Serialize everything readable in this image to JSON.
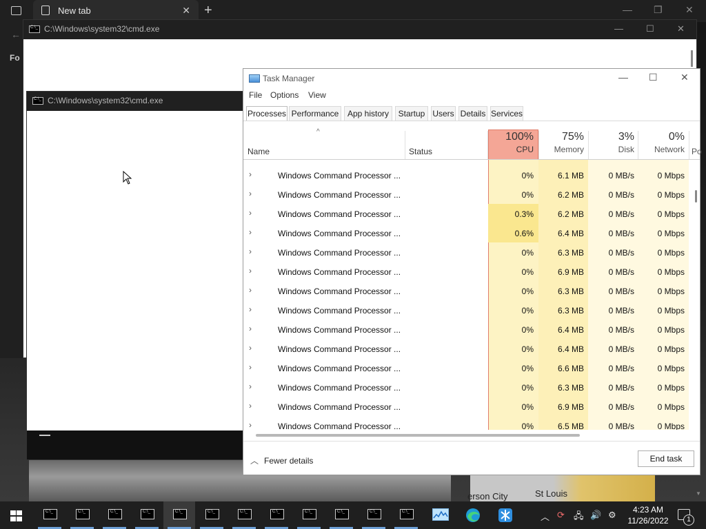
{
  "browser": {
    "tab_title": "New tab",
    "side_text": "Fo"
  },
  "cmd_window_back": {
    "title": "C:\\Windows\\system32\\cmd.exe"
  },
  "cmd_window_front": {
    "title": "C:\\Windows\\system32\\cmd.exe"
  },
  "task_manager": {
    "title": "Task Manager",
    "menu": [
      "File",
      "Options",
      "View"
    ],
    "tabs": [
      "Processes",
      "Performance",
      "App history",
      "Startup",
      "Users",
      "Details",
      "Services"
    ],
    "active_tab": "Processes",
    "columns": {
      "name": "Name",
      "status": "Status",
      "cpu": {
        "pct": "100%",
        "label": "CPU"
      },
      "memory": {
        "pct": "75%",
        "label": "Memory"
      },
      "disk": {
        "pct": "3%",
        "label": "Disk"
      },
      "network": {
        "pct": "0%",
        "label": "Network"
      },
      "next": "Po"
    },
    "rows": [
      {
        "name": "Windows Command Processor ...",
        "cpu": "0%",
        "memory": "6.1 MB",
        "disk": "0 MB/s",
        "network": "0 Mbps"
      },
      {
        "name": "Windows Command Processor ...",
        "cpu": "0%",
        "memory": "6.2 MB",
        "disk": "0 MB/s",
        "network": "0 Mbps"
      },
      {
        "name": "Windows Command Processor ...",
        "cpu": "0.3%",
        "memory": "6.2 MB",
        "disk": "0 MB/s",
        "network": "0 Mbps"
      },
      {
        "name": "Windows Command Processor ...",
        "cpu": "0.6%",
        "memory": "6.4 MB",
        "disk": "0 MB/s",
        "network": "0 Mbps"
      },
      {
        "name": "Windows Command Processor ...",
        "cpu": "0%",
        "memory": "6.3 MB",
        "disk": "0 MB/s",
        "network": "0 Mbps"
      },
      {
        "name": "Windows Command Processor ...",
        "cpu": "0%",
        "memory": "6.9 MB",
        "disk": "0 MB/s",
        "network": "0 Mbps"
      },
      {
        "name": "Windows Command Processor ...",
        "cpu": "0%",
        "memory": "6.3 MB",
        "disk": "0 MB/s",
        "network": "0 Mbps"
      },
      {
        "name": "Windows Command Processor ...",
        "cpu": "0%",
        "memory": "6.3 MB",
        "disk": "0 MB/s",
        "network": "0 Mbps"
      },
      {
        "name": "Windows Command Processor ...",
        "cpu": "0%",
        "memory": "6.4 MB",
        "disk": "0 MB/s",
        "network": "0 Mbps"
      },
      {
        "name": "Windows Command Processor ...",
        "cpu": "0%",
        "memory": "6.4 MB",
        "disk": "0 MB/s",
        "network": "0 Mbps"
      },
      {
        "name": "Windows Command Processor ...",
        "cpu": "0%",
        "memory": "6.6 MB",
        "disk": "0 MB/s",
        "network": "0 Mbps"
      },
      {
        "name": "Windows Command Processor ...",
        "cpu": "0%",
        "memory": "6.3 MB",
        "disk": "0 MB/s",
        "network": "0 Mbps"
      },
      {
        "name": "Windows Command Processor ...",
        "cpu": "0%",
        "memory": "6.9 MB",
        "disk": "0 MB/s",
        "network": "0 Mbps"
      },
      {
        "name": "Windows Command Processor ...",
        "cpu": "0%",
        "memory": "6.5 MB",
        "disk": "0 MB/s",
        "network": "0 Mbps"
      }
    ],
    "fewer_details": "Fewer details",
    "end_task": "End task"
  },
  "wallpaper": {
    "label_left": "erson City",
    "label_right": "St Louis"
  },
  "taskbar": {
    "time": "4:23 AM",
    "date": "11/26/2022",
    "notification_count": "1",
    "cmd_app_count": 12
  },
  "colors": {
    "cpu_header": "#f4a696",
    "cpu_cell_high": "#fae78f",
    "cpu_cell": "#fdf3c4",
    "mem_cell": "#fdf0b8",
    "disk_cell": "#fff9e0",
    "taskbar": "#1f1f1f",
    "accent": "#6ea0d6"
  }
}
